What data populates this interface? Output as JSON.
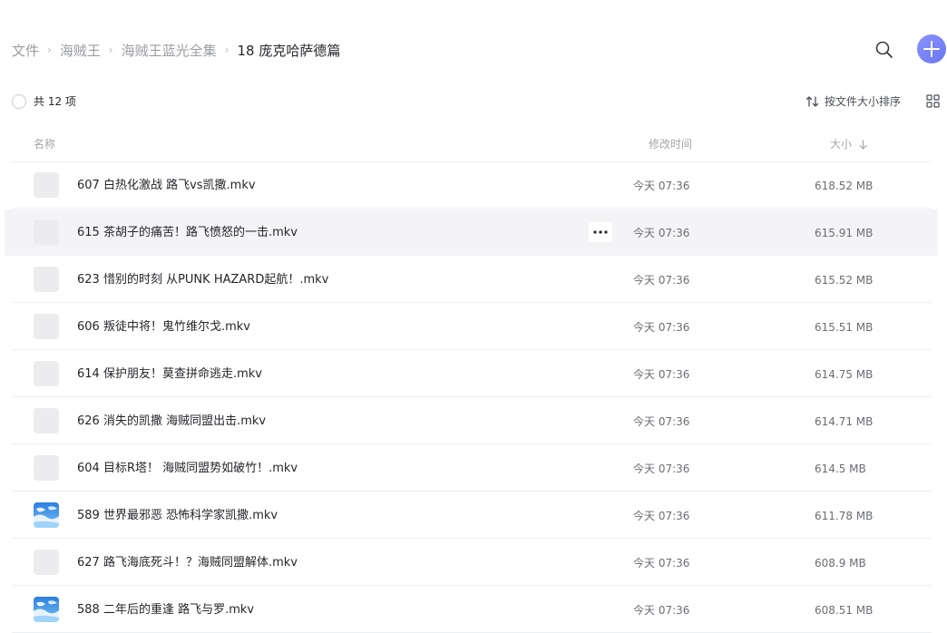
{
  "breadcrumb": {
    "items": [
      "文件",
      "海贼王",
      "海贼王蓝光全集"
    ],
    "current": "18 庞克哈萨德篇",
    "separator": "›"
  },
  "header": {
    "search_icon": "search-icon",
    "add_icon": "plus-icon",
    "accent_color": "#7b84fa"
  },
  "toolbar": {
    "count_label": "共 12 项",
    "sort_label": "按文件大小排序",
    "view_icon": "grid-view-icon"
  },
  "columns": {
    "name": "名称",
    "modified": "修改时间",
    "size": "大小"
  },
  "files": [
    {
      "name": "607 白热化激战 路飞vs凯撒.mkv",
      "time": "今天 07:36",
      "size": "618.52 MB",
      "thumb": "blank"
    },
    {
      "name": "615 茶胡子的痛苦！路飞愤怒的一击.mkv",
      "time": "今天 07:36",
      "size": "615.91 MB",
      "thumb": "blank",
      "hovered": true
    },
    {
      "name": "623 惜别的时刻 从PUNK HAZARD起航！.mkv",
      "time": "今天 07:36",
      "size": "615.52 MB",
      "thumb": "blank"
    },
    {
      "name": "606 叛徒中将！鬼竹维尔戈.mkv",
      "time": "今天 07:36",
      "size": "615.51 MB",
      "thumb": "blank"
    },
    {
      "name": "614 保护朋友！莫查拼命逃走.mkv",
      "time": "今天 07:36",
      "size": "614.75 MB",
      "thumb": "blank"
    },
    {
      "name": "626 消失的凯撒 海贼同盟出击.mkv",
      "time": "今天 07:36",
      "size": "614.71 MB",
      "thumb": "blank"
    },
    {
      "name": "604 目标R塔！ 海贼同盟势如破竹！.mkv",
      "time": "今天 07:36",
      "size": "614.5 MB",
      "thumb": "blank"
    },
    {
      "name": "589 世界最邪恶 恐怖科学家凯撒.mkv",
      "time": "今天 07:36",
      "size": "611.78 MB",
      "thumb": "image"
    },
    {
      "name": "627 路飞海底死斗！？海贼同盟解体.mkv",
      "time": "今天 07:36",
      "size": "608.9 MB",
      "thumb": "blank"
    },
    {
      "name": "588 二年后的重逢 路飞与罗.mkv",
      "time": "今天 07:36",
      "size": "608.51 MB",
      "thumb": "image"
    }
  ],
  "row_actions": {
    "more_icon": "more-horizontal-icon"
  }
}
